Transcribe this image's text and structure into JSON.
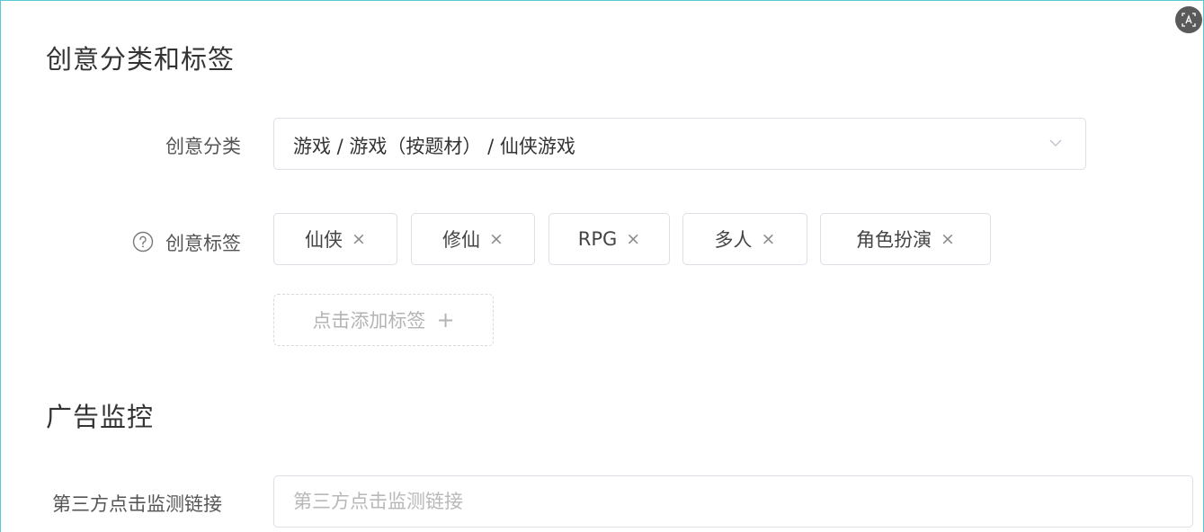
{
  "sections": {
    "creative": {
      "title": "创意分类和标签",
      "category_label": "创意分类",
      "category_value": "游戏 / 游戏（按题材） / 仙侠游戏",
      "tags_label": "创意标签",
      "tags": [
        {
          "label": "仙侠"
        },
        {
          "label": "修仙"
        },
        {
          "label": "RPG"
        },
        {
          "label": "多人"
        },
        {
          "label": "角色扮演"
        }
      ],
      "tag_close_glyph": "×",
      "add_tag_label": "点击添加标签",
      "add_tag_glyph": "+"
    },
    "monitoring": {
      "title": "广告监控",
      "click_url_label": "第三方点击监测链接",
      "click_url_value": "",
      "click_url_placeholder": "第三方点击监测链接"
    }
  },
  "icons": {
    "category_dropdown": "chevron-down-icon",
    "tags_help": "question-circle-icon",
    "corner_tool": "translate-icon"
  },
  "colors": {
    "border": "#dcdfe6",
    "frame_accent": "#5cc8d6",
    "placeholder": "#b8b8b8"
  }
}
